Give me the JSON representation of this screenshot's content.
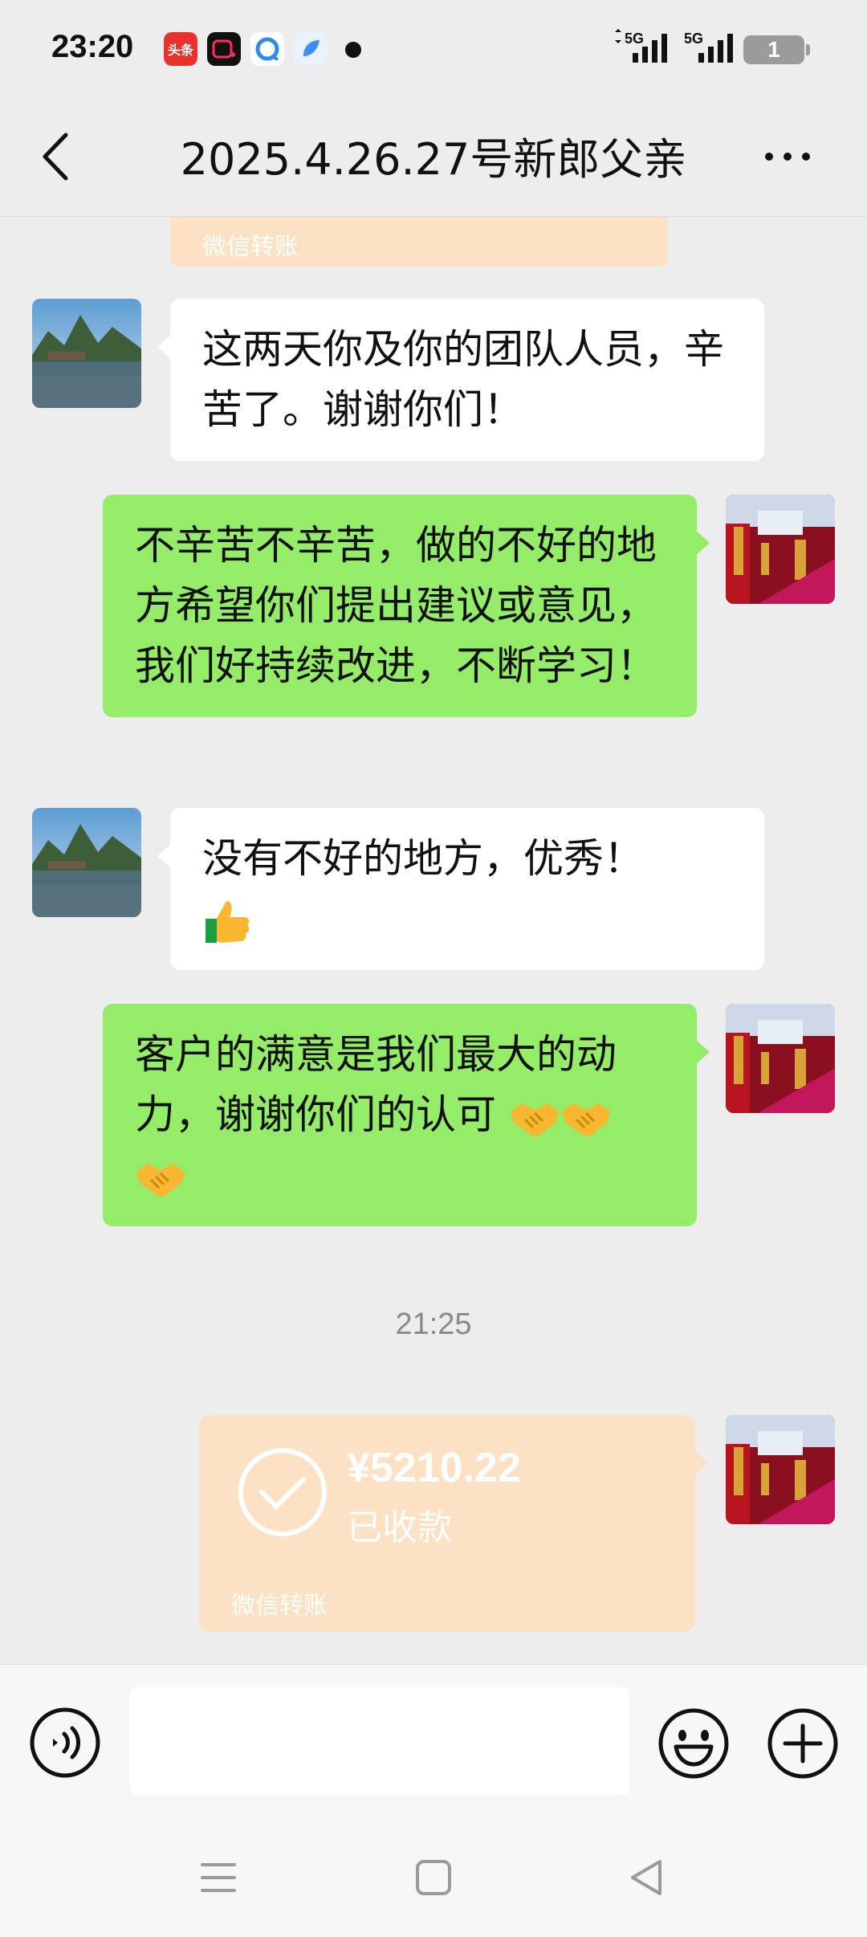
{
  "status_bar": {
    "time": "23:20",
    "apps": [
      {
        "name": "toutiao-icon",
        "label": "头条",
        "color": "#e8322c"
      },
      {
        "name": "video-app-icon",
        "label": "",
        "color": "#111111"
      },
      {
        "name": "browser-app-icon",
        "label": "",
        "color": "#2a8cf2"
      },
      {
        "name": "bird-app-icon",
        "label": "",
        "color": "#3b8ff5"
      }
    ],
    "signal_1": "5G",
    "signal_2": "5G",
    "battery": "1"
  },
  "header": {
    "title": "2025.4.26.27号新郎父亲"
  },
  "messages": {
    "transfer_top_label": "微信转账",
    "m1_text": "这两天你及你的团队人员，辛苦了。谢谢你们！",
    "m2_text": "不辛苦不辛苦，做的不好的地方希望你们提出建议或意见，我们好持续改进，不断学习！",
    "m3_text": "没有不好的地方，优秀！",
    "m3_emoji": "thumbs-up",
    "m4_text": "客户的满意是我们最大的动力，谢谢你们的认可",
    "m4_emoji": "handshake ×3",
    "timestamp": "21:25",
    "transfer": {
      "amount": "¥5210.22",
      "status": "已收款",
      "label": "微信转账"
    }
  },
  "input": {
    "placeholder": ""
  },
  "colors": {
    "background": "#ededed",
    "outgoing_bubble": "#95ec69",
    "incoming_bubble": "#ffffff",
    "transfer_card": "#fde1c4"
  }
}
